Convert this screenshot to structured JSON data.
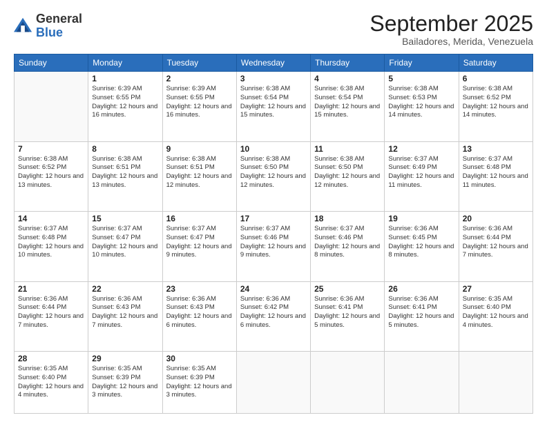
{
  "logo": {
    "general": "General",
    "blue": "Blue"
  },
  "header": {
    "month": "September 2025",
    "location": "Bailadores, Merida, Venezuela"
  },
  "weekdays": [
    "Sunday",
    "Monday",
    "Tuesday",
    "Wednesday",
    "Thursday",
    "Friday",
    "Saturday"
  ],
  "weeks": [
    [
      {
        "day": "",
        "empty": true
      },
      {
        "day": "1",
        "sunrise": "Sunrise: 6:39 AM",
        "sunset": "Sunset: 6:55 PM",
        "daylight": "Daylight: 12 hours and 16 minutes."
      },
      {
        "day": "2",
        "sunrise": "Sunrise: 6:39 AM",
        "sunset": "Sunset: 6:55 PM",
        "daylight": "Daylight: 12 hours and 16 minutes."
      },
      {
        "day": "3",
        "sunrise": "Sunrise: 6:38 AM",
        "sunset": "Sunset: 6:54 PM",
        "daylight": "Daylight: 12 hours and 15 minutes."
      },
      {
        "day": "4",
        "sunrise": "Sunrise: 6:38 AM",
        "sunset": "Sunset: 6:54 PM",
        "daylight": "Daylight: 12 hours and 15 minutes."
      },
      {
        "day": "5",
        "sunrise": "Sunrise: 6:38 AM",
        "sunset": "Sunset: 6:53 PM",
        "daylight": "Daylight: 12 hours and 14 minutes."
      },
      {
        "day": "6",
        "sunrise": "Sunrise: 6:38 AM",
        "sunset": "Sunset: 6:52 PM",
        "daylight": "Daylight: 12 hours and 14 minutes."
      }
    ],
    [
      {
        "day": "7",
        "sunrise": "Sunrise: 6:38 AM",
        "sunset": "Sunset: 6:52 PM",
        "daylight": "Daylight: 12 hours and 13 minutes."
      },
      {
        "day": "8",
        "sunrise": "Sunrise: 6:38 AM",
        "sunset": "Sunset: 6:51 PM",
        "daylight": "Daylight: 12 hours and 13 minutes."
      },
      {
        "day": "9",
        "sunrise": "Sunrise: 6:38 AM",
        "sunset": "Sunset: 6:51 PM",
        "daylight": "Daylight: 12 hours and 12 minutes."
      },
      {
        "day": "10",
        "sunrise": "Sunrise: 6:38 AM",
        "sunset": "Sunset: 6:50 PM",
        "daylight": "Daylight: 12 hours and 12 minutes."
      },
      {
        "day": "11",
        "sunrise": "Sunrise: 6:38 AM",
        "sunset": "Sunset: 6:50 PM",
        "daylight": "Daylight: 12 hours and 12 minutes."
      },
      {
        "day": "12",
        "sunrise": "Sunrise: 6:37 AM",
        "sunset": "Sunset: 6:49 PM",
        "daylight": "Daylight: 12 hours and 11 minutes."
      },
      {
        "day": "13",
        "sunrise": "Sunrise: 6:37 AM",
        "sunset": "Sunset: 6:48 PM",
        "daylight": "Daylight: 12 hours and 11 minutes."
      }
    ],
    [
      {
        "day": "14",
        "sunrise": "Sunrise: 6:37 AM",
        "sunset": "Sunset: 6:48 PM",
        "daylight": "Daylight: 12 hours and 10 minutes."
      },
      {
        "day": "15",
        "sunrise": "Sunrise: 6:37 AM",
        "sunset": "Sunset: 6:47 PM",
        "daylight": "Daylight: 12 hours and 10 minutes."
      },
      {
        "day": "16",
        "sunrise": "Sunrise: 6:37 AM",
        "sunset": "Sunset: 6:47 PM",
        "daylight": "Daylight: 12 hours and 9 minutes."
      },
      {
        "day": "17",
        "sunrise": "Sunrise: 6:37 AM",
        "sunset": "Sunset: 6:46 PM",
        "daylight": "Daylight: 12 hours and 9 minutes."
      },
      {
        "day": "18",
        "sunrise": "Sunrise: 6:37 AM",
        "sunset": "Sunset: 6:46 PM",
        "daylight": "Daylight: 12 hours and 8 minutes."
      },
      {
        "day": "19",
        "sunrise": "Sunrise: 6:36 AM",
        "sunset": "Sunset: 6:45 PM",
        "daylight": "Daylight: 12 hours and 8 minutes."
      },
      {
        "day": "20",
        "sunrise": "Sunrise: 6:36 AM",
        "sunset": "Sunset: 6:44 PM",
        "daylight": "Daylight: 12 hours and 7 minutes."
      }
    ],
    [
      {
        "day": "21",
        "sunrise": "Sunrise: 6:36 AM",
        "sunset": "Sunset: 6:44 PM",
        "daylight": "Daylight: 12 hours and 7 minutes."
      },
      {
        "day": "22",
        "sunrise": "Sunrise: 6:36 AM",
        "sunset": "Sunset: 6:43 PM",
        "daylight": "Daylight: 12 hours and 7 minutes."
      },
      {
        "day": "23",
        "sunrise": "Sunrise: 6:36 AM",
        "sunset": "Sunset: 6:43 PM",
        "daylight": "Daylight: 12 hours and 6 minutes."
      },
      {
        "day": "24",
        "sunrise": "Sunrise: 6:36 AM",
        "sunset": "Sunset: 6:42 PM",
        "daylight": "Daylight: 12 hours and 6 minutes."
      },
      {
        "day": "25",
        "sunrise": "Sunrise: 6:36 AM",
        "sunset": "Sunset: 6:41 PM",
        "daylight": "Daylight: 12 hours and 5 minutes."
      },
      {
        "day": "26",
        "sunrise": "Sunrise: 6:36 AM",
        "sunset": "Sunset: 6:41 PM",
        "daylight": "Daylight: 12 hours and 5 minutes."
      },
      {
        "day": "27",
        "sunrise": "Sunrise: 6:35 AM",
        "sunset": "Sunset: 6:40 PM",
        "daylight": "Daylight: 12 hours and 4 minutes."
      }
    ],
    [
      {
        "day": "28",
        "sunrise": "Sunrise: 6:35 AM",
        "sunset": "Sunset: 6:40 PM",
        "daylight": "Daylight: 12 hours and 4 minutes."
      },
      {
        "day": "29",
        "sunrise": "Sunrise: 6:35 AM",
        "sunset": "Sunset: 6:39 PM",
        "daylight": "Daylight: 12 hours and 3 minutes."
      },
      {
        "day": "30",
        "sunrise": "Sunrise: 6:35 AM",
        "sunset": "Sunset: 6:39 PM",
        "daylight": "Daylight: 12 hours and 3 minutes."
      },
      {
        "day": "",
        "empty": true
      },
      {
        "day": "",
        "empty": true
      },
      {
        "day": "",
        "empty": true
      },
      {
        "day": "",
        "empty": true
      }
    ]
  ]
}
